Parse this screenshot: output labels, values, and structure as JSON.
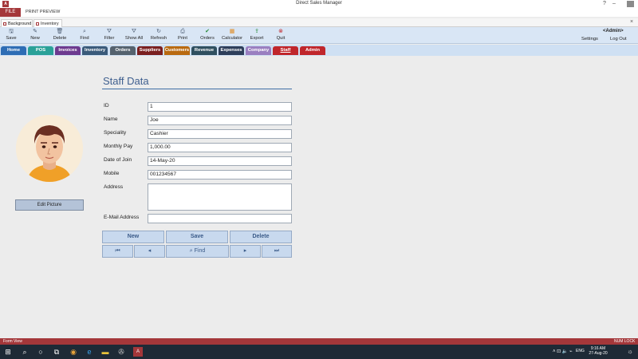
{
  "window": {
    "app_logo": "A",
    "title": "Direct Sales Manager",
    "controls": [
      "?",
      "–",
      "▢",
      "✕"
    ]
  },
  "ribbon": {
    "file": "FILE",
    "print_preview": "PRINT PREVIEW"
  },
  "doc_tabs": [
    {
      "label": "Background"
    },
    {
      "label": "Inventory"
    }
  ],
  "doc_close": "×",
  "toolbar": {
    "items": [
      {
        "label": "Save",
        "icon": "save-icon",
        "glyph": "🖫"
      },
      {
        "label": "New",
        "icon": "new-icon",
        "glyph": "✎"
      },
      {
        "label": "Delete",
        "icon": "delete-icon",
        "glyph": "🗑"
      },
      {
        "label": "Find",
        "icon": "find-icon",
        "glyph": "⌕"
      },
      {
        "label": "Filter",
        "icon": "filter-icon",
        "glyph": "⛛"
      },
      {
        "label": "Show All",
        "icon": "show-all-icon",
        "glyph": "⛛"
      },
      {
        "label": "Refresh",
        "icon": "refresh-icon",
        "glyph": "↻"
      },
      {
        "label": "Print",
        "icon": "print-icon",
        "glyph": "⎙"
      },
      {
        "label": "Orders",
        "icon": "orders-icon",
        "glyph": "✔"
      },
      {
        "label": "Calculator",
        "icon": "calculator-icon",
        "glyph": "▦"
      },
      {
        "label": "Export",
        "icon": "export-icon",
        "glyph": "⇪"
      },
      {
        "label": "Quit",
        "icon": "quit-icon",
        "glyph": "⊗"
      }
    ],
    "user": "<Admin>",
    "settings": "Settings",
    "logout": "Log Out"
  },
  "nav_tabs": [
    {
      "label": "Home",
      "color": "#2e6db4"
    },
    {
      "label": "POS",
      "color": "#2aa198"
    },
    {
      "label": "Invoices",
      "color": "#6d3a8f"
    },
    {
      "label": "Inventory",
      "color": "#3a5a7a"
    },
    {
      "label": "Orders",
      "color": "#55626e"
    },
    {
      "label": "Suppliers",
      "color": "#7a1f1f"
    },
    {
      "label": "Customers",
      "color": "#b96a10"
    },
    {
      "label": "Revenue",
      "color": "#2f4f5f"
    },
    {
      "label": "Expenses",
      "color": "#2d3e5a"
    },
    {
      "label": "Company",
      "color": "#9a7fc0"
    },
    {
      "label": "Staff",
      "color": "#c0262b"
    },
    {
      "label": "Admin",
      "color": "#c0262b"
    }
  ],
  "form": {
    "title": "Staff Data",
    "fields": [
      {
        "label": "ID",
        "value": "1"
      },
      {
        "label": "Name",
        "value": "Joe"
      },
      {
        "label": "Speciality",
        "value": "Cashier"
      },
      {
        "label": "Monthly Pay",
        "value": "1,000.00"
      },
      {
        "label": "Date of Join",
        "value": "14-May-20"
      },
      {
        "label": "Mobile",
        "value": "001234567"
      },
      {
        "label": "Address",
        "value": ""
      },
      {
        "label": "E-Mail Address",
        "value": ""
      }
    ],
    "edit_picture": "Edit Picture",
    "buttons": {
      "new": "New",
      "save": "Save",
      "delete": "Delete",
      "find": "Find"
    },
    "record_nav": {
      "first": "⏮",
      "prev": "◂",
      "find_icon": "⌕",
      "next": "▸",
      "last": "⏭"
    }
  },
  "status": {
    "left": "Form View",
    "right": "NUM LOCK"
  },
  "taskbar": {
    "time": "9:16 AM",
    "date": "27-Aug-20",
    "lang": "ENG",
    "tray": "˄ ⊡ 🔈 ⌁"
  }
}
